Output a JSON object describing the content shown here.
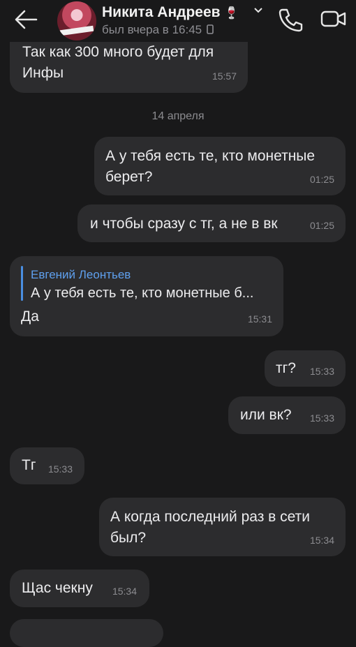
{
  "header": {
    "contact_name": "Никита Андреев",
    "name_emoji": "🍷",
    "status": "был вчера в 16:45",
    "icons": [
      "back-arrow-icon",
      "chevron-down-icon",
      "phone-icon",
      "video-camera-icon",
      "phone-device-icon"
    ]
  },
  "date_divider": "14 апреля",
  "messages": [
    {
      "side": "in",
      "text": "Так как 300 много будет для\nИнфы",
      "time": "15:57"
    },
    {
      "side": "out",
      "text": "А у тебя есть те, кто монетные\nберет?",
      "time": "01:25"
    },
    {
      "side": "out",
      "text": "и чтобы сразу с тг, а не в вк",
      "time": "01:25"
    },
    {
      "side": "in",
      "reply_to_name": "Евгений Леонтьев",
      "reply_to_text": "А у тебя есть те, кто монетные б...",
      "text": "Да",
      "time": "15:31"
    },
    {
      "side": "out",
      "text": "тг?",
      "time": "15:33"
    },
    {
      "side": "out",
      "text": "или вк?",
      "time": "15:33"
    },
    {
      "side": "in",
      "text": "Тг",
      "time": "15:33"
    },
    {
      "side": "out",
      "text": "А когда последний раз в сети\nбыл?",
      "time": "15:34"
    },
    {
      "side": "in",
      "text": "Щас чекну",
      "time": "15:34"
    }
  ],
  "colors": {
    "background": "#19191a",
    "bubble": "#2c2c2e",
    "accent": "#4a8fe2",
    "meta": "#8c8c90"
  }
}
